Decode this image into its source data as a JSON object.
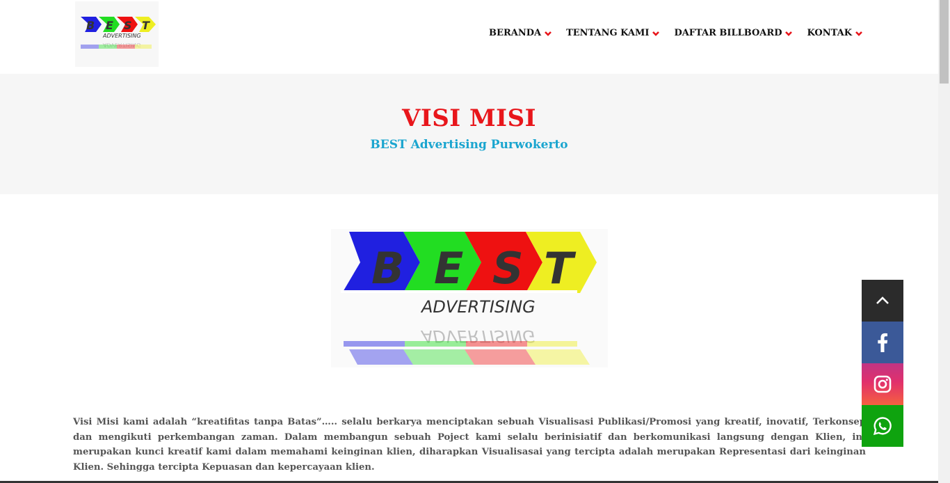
{
  "header": {
    "logo_alt": "BEST Advertising",
    "nav": [
      {
        "label": "BERANDA"
      },
      {
        "label": "TENTANG KAMI"
      },
      {
        "label": "DAFTAR BILLBOARD"
      },
      {
        "label": "KONTAK"
      }
    ]
  },
  "banner": {
    "title": "VISI MISI",
    "subtitle": "BEST Advertising Purwokerto"
  },
  "logo_text": {
    "letters": [
      "B",
      "E",
      "S",
      "T"
    ],
    "word": "ADVERTISING"
  },
  "content": {
    "paragraph": "Visi Misi kami adalah “kreatifitas tanpa Batas”….. selalu berkarya menciptakan sebuah Visualisasi Publikasi/Promosi yang kreatif, inovatif, Terkonsep dan mengikuti perkembangan zaman. Dalam membangun sebuah Poject kami selalu berinisiatif dan berkomunikasi langsung dengan Klien, ini merupakan kunci kreatif kami dalam memahami keinginan klien, diharapkan Visualisasai yang tercipta adalah merupakan Representasi dari keinginan Klien. Sehingga tercipta Kepuasan dan kepercayaan klien."
  },
  "floating": {
    "icons": [
      "chevron-up-icon",
      "facebook-icon",
      "instagram-icon",
      "whatsapp-icon"
    ]
  },
  "colors": {
    "title_red": "#e8161b",
    "subtitle_blue": "#1aa5cf",
    "logo_blue": "#2020e0",
    "logo_green": "#22dd22",
    "logo_red": "#ee1111",
    "logo_yellow": "#eeee22",
    "facebook": "#3b5998",
    "whatsapp": "#0fa30f"
  }
}
